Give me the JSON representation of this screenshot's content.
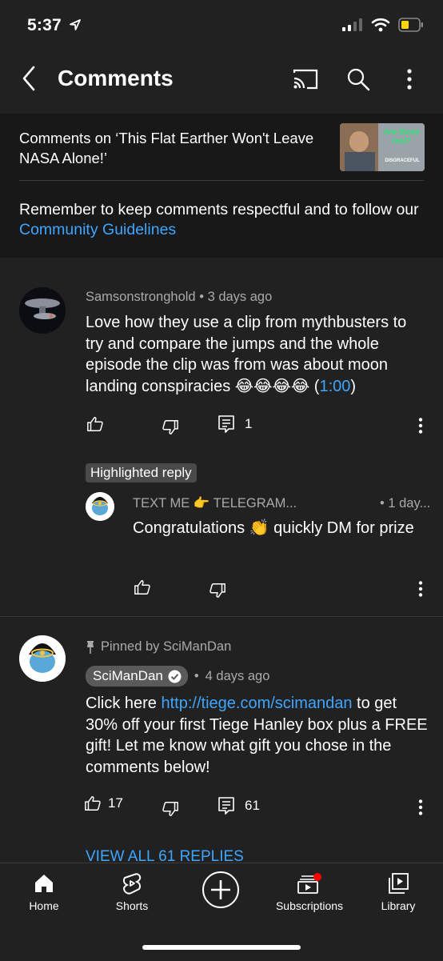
{
  "status": {
    "time": "5:37"
  },
  "header": {
    "title": "Comments"
  },
  "video": {
    "comments_on": "Comments on ‘This Flat Earther Won't Leave NASA Alone!’",
    "thumb_overlay": "Are these real?",
    "thumb_caption": "DISGRACEFUL"
  },
  "guidelines": {
    "text": "Remember to keep comments respectful and to follow our ",
    "link": "Community Guidelines"
  },
  "comment1": {
    "author": "Samsonstronghold",
    "time": "3 days ago",
    "text_before": "Love how they use a clip from mythbusters to try and compare the jumps and the whole episode the clip was from was about moon landing conspiracies 😂😂😂😂 (",
    "timestamp": "1:00",
    "text_after": ")",
    "reply_count": "1",
    "highlight_label": "Highlighted reply",
    "reply": {
      "author": "TEXT ME 👉 TELEGRAM...",
      "time": "1 day...",
      "text": "Congratulations 👏 quickly DM for prize"
    }
  },
  "comment2": {
    "pinned": "Pinned by SciManDan",
    "author": "SciManDan",
    "time": "4 days ago",
    "text_before": "Click here ",
    "link": "http://tiege.com/scimandan",
    "text_after": " to get 30% off your first Tiege Hanley box plus a FREE gift! Let me know what gift you chose in the comments below!",
    "likes": "17",
    "reply_count": "61",
    "view_replies": "VIEW ALL 61 REPLIES"
  },
  "nav": {
    "home": "Home",
    "shorts": "Shorts",
    "subscriptions": "Subscriptions",
    "library": "Library"
  },
  "colors": {
    "background": "#212121",
    "link": "#3ea6ff",
    "muted": "#aaaaaa",
    "badge": "#ff0000"
  }
}
